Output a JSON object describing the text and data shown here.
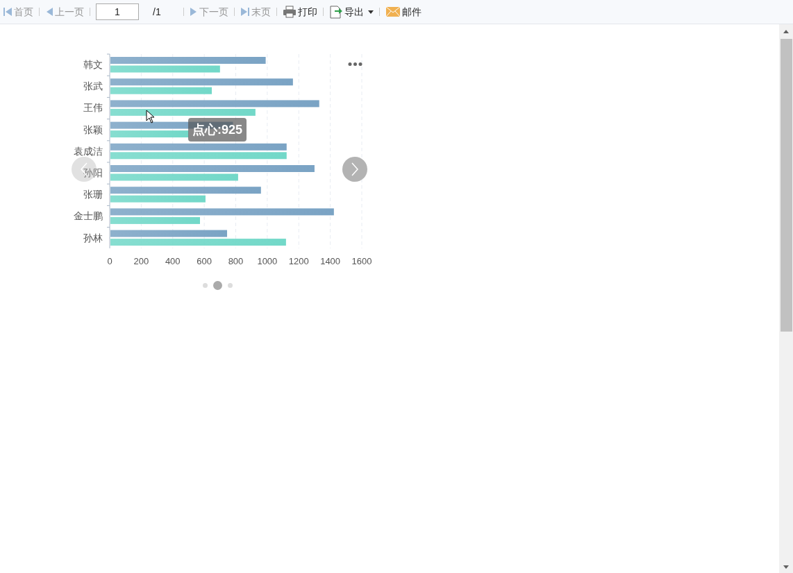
{
  "toolbar": {
    "items": [
      {
        "kind": "first",
        "label": "首页",
        "disabled": true
      },
      {
        "kind": "prev",
        "label": "上一页",
        "disabled": true
      },
      {
        "kind": "page",
        "value": "1",
        "total": "/1"
      },
      {
        "kind": "next",
        "label": "下一页",
        "disabled": true
      },
      {
        "kind": "last",
        "label": "末页",
        "disabled": true
      },
      {
        "kind": "print",
        "label": "打印",
        "disabled": false
      },
      {
        "kind": "export",
        "label": "导出",
        "disabled": false
      },
      {
        "kind": "mail",
        "label": "邮件",
        "disabled": false
      }
    ]
  },
  "chart": {
    "chart_data": {
      "type": "bar",
      "orientation": "horizontal",
      "categories": [
        "韩文",
        "张武",
        "王伟",
        "张颖",
        "袁成洁",
        "孙阳",
        "张珊",
        "金士鹏",
        "孙林"
      ],
      "series": [
        {
          "color": "#7aa3c4",
          "values": [
            990,
            1163,
            1330,
            782,
            1123,
            1300,
            960,
            1423,
            745
          ]
        },
        {
          "color": "#72d8c8",
          "values": [
            700,
            648,
            925,
            500,
            1123,
            815,
            608,
            573,
            1119
          ]
        }
      ],
      "xlim": [
        0,
        1600
      ],
      "grid": true,
      "xticks": [
        0,
        200,
        400,
        600,
        800,
        1000,
        1200,
        1400,
        1600
      ]
    },
    "tooltip": {
      "text": "点心:925"
    },
    "carousel": {
      "pages": [
        {
          "selected": false
        },
        {
          "selected": true
        },
        {
          "selected": false
        }
      ]
    }
  }
}
